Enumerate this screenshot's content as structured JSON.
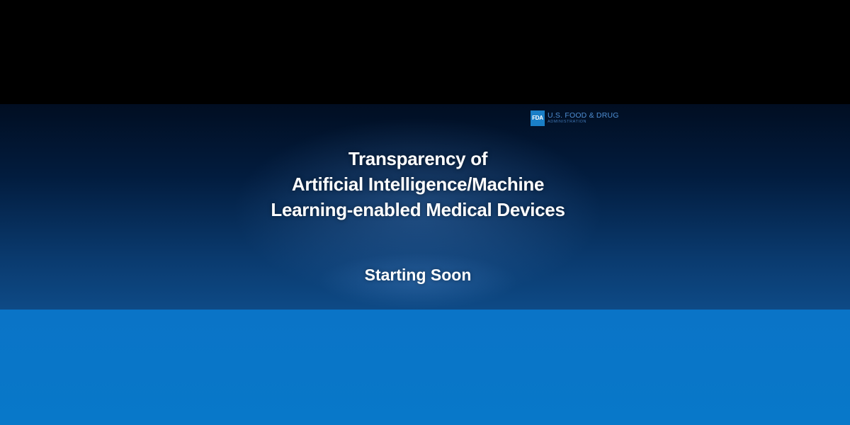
{
  "logo": {
    "mark": "FDA",
    "name": "U.S. FOOD & DRUG",
    "subtitle": "ADMINISTRATION",
    "icon": "fda-logo-icon"
  },
  "slide": {
    "title_lines": [
      "Transparency of",
      "Artificial Intelligence/Machine",
      "Learning-enabled Medical Devices"
    ],
    "status": "Starting Soon"
  },
  "colors": {
    "top_bar": "#000000",
    "slide_dark": "#010e22",
    "slide_light": "#0e4a86",
    "bottom_bar": "#0a74c7",
    "logo_accent": "#1a7fc7"
  }
}
